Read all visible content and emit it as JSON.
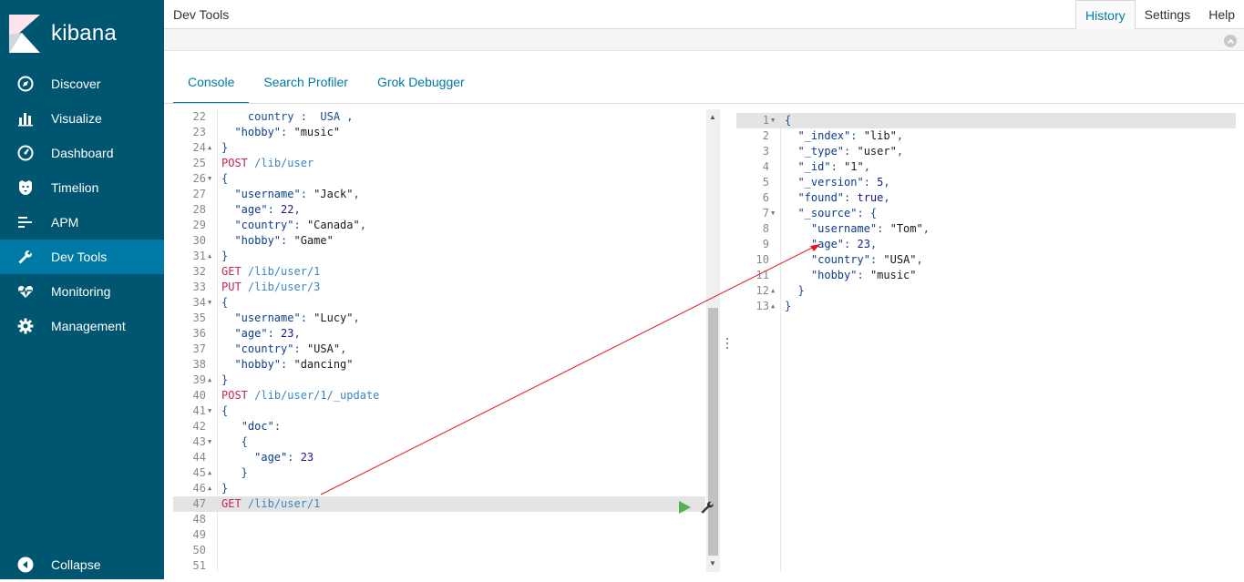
{
  "app": {
    "brand": "kibana",
    "page_title": "Dev Tools"
  },
  "topmenu": [
    "History",
    "Settings",
    "Help"
  ],
  "sidebar": {
    "items": [
      {
        "label": "Discover",
        "icon": "compass-icon"
      },
      {
        "label": "Visualize",
        "icon": "bar-chart-icon"
      },
      {
        "label": "Dashboard",
        "icon": "dashboard-icon"
      },
      {
        "label": "Timelion",
        "icon": "timelion-icon"
      },
      {
        "label": "APM",
        "icon": "apm-icon"
      },
      {
        "label": "Dev Tools",
        "icon": "wrench-icon"
      },
      {
        "label": "Monitoring",
        "icon": "heartbeat-icon"
      },
      {
        "label": "Management",
        "icon": "gear-icon"
      }
    ],
    "collapse_label": "Collapse"
  },
  "tabs": [
    "Console",
    "Search Profiler",
    "Grok Debugger"
  ],
  "editor": {
    "lines": [
      {
        "n": "22",
        "fold": "",
        "code": "    country :  USA ,"
      },
      {
        "n": "23",
        "fold": "",
        "code": "  \"hobby\": \"music\""
      },
      {
        "n": "24",
        "fold": "▲",
        "code": "}"
      },
      {
        "n": "25",
        "fold": "",
        "code": "POST /lib/user"
      },
      {
        "n": "26",
        "fold": "▼",
        "code": "{"
      },
      {
        "n": "27",
        "fold": "",
        "code": "  \"username\": \"Jack\","
      },
      {
        "n": "28",
        "fold": "",
        "code": "  \"age\": 22,"
      },
      {
        "n": "29",
        "fold": "",
        "code": "  \"country\": \"Canada\","
      },
      {
        "n": "30",
        "fold": "",
        "code": "  \"hobby\": \"Game\""
      },
      {
        "n": "31",
        "fold": "▲",
        "code": "}"
      },
      {
        "n": "32",
        "fold": "",
        "code": "GET /lib/user/1"
      },
      {
        "n": "33",
        "fold": "",
        "code": "PUT /lib/user/3"
      },
      {
        "n": "34",
        "fold": "▼",
        "code": "{"
      },
      {
        "n": "35",
        "fold": "",
        "code": "  \"username\": \"Lucy\","
      },
      {
        "n": "36",
        "fold": "",
        "code": "  \"age\": 23,"
      },
      {
        "n": "37",
        "fold": "",
        "code": "  \"country\": \"USA\","
      },
      {
        "n": "38",
        "fold": "",
        "code": "  \"hobby\": \"dancing\""
      },
      {
        "n": "39",
        "fold": "▲",
        "code": "}"
      },
      {
        "n": "40",
        "fold": "",
        "code": "POST /lib/user/1/_update"
      },
      {
        "n": "41",
        "fold": "▼",
        "code": "{"
      },
      {
        "n": "42",
        "fold": "",
        "code": "   \"doc\":"
      },
      {
        "n": "43",
        "fold": "▼",
        "code": "   {"
      },
      {
        "n": "44",
        "fold": "",
        "code": "     \"age\": 23"
      },
      {
        "n": "45",
        "fold": "▲",
        "code": "   }"
      },
      {
        "n": "46",
        "fold": "▲",
        "code": "}"
      },
      {
        "n": "47",
        "fold": "",
        "code": "GET /lib/user/1"
      },
      {
        "n": "48",
        "fold": "",
        "code": ""
      },
      {
        "n": "49",
        "fold": "",
        "code": ""
      },
      {
        "n": "50",
        "fold": "",
        "code": ""
      },
      {
        "n": "51",
        "fold": "",
        "code": ""
      }
    ]
  },
  "output": {
    "lines": [
      {
        "n": "1",
        "fold": "▼",
        "code": "{"
      },
      {
        "n": "2",
        "fold": "",
        "code": "  \"_index\": \"lib\","
      },
      {
        "n": "3",
        "fold": "",
        "code": "  \"_type\": \"user\","
      },
      {
        "n": "4",
        "fold": "",
        "code": "  \"_id\": \"1\","
      },
      {
        "n": "5",
        "fold": "",
        "code": "  \"_version\": 5,"
      },
      {
        "n": "6",
        "fold": "",
        "code": "  \"found\": true,"
      },
      {
        "n": "7",
        "fold": "▼",
        "code": "  \"_source\": {"
      },
      {
        "n": "8",
        "fold": "",
        "code": "    \"username\": \"Tom\","
      },
      {
        "n": "9",
        "fold": "",
        "code": "    \"age\": 23,"
      },
      {
        "n": "10",
        "fold": "",
        "code": "    \"country\": \"USA\","
      },
      {
        "n": "11",
        "fold": "",
        "code": "    \"hobby\": \"music\""
      },
      {
        "n": "12",
        "fold": "▲",
        "code": "  }"
      },
      {
        "n": "13",
        "fold": "▲",
        "code": "}"
      }
    ]
  },
  "colors": {
    "sidebar": "#005571",
    "active": "#0079a5",
    "accent": "#0079a5",
    "arrow": "#e8151b"
  }
}
